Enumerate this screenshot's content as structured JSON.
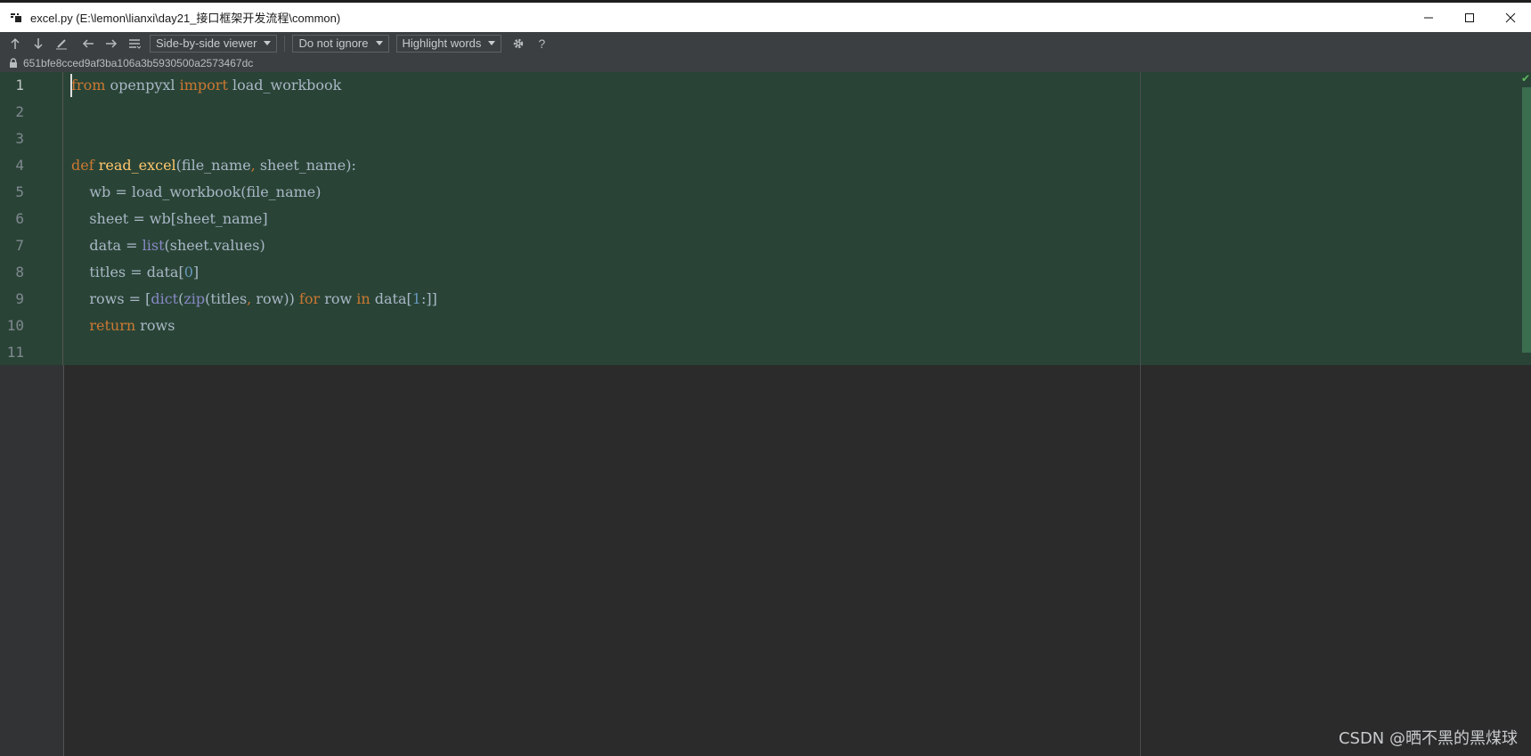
{
  "window": {
    "title": "excel.py (E:\\lemon\\lianxi\\day21_接口框架开发流程\\common)",
    "controls": {
      "minimize": "—",
      "maximize": "☐",
      "close": "✕"
    }
  },
  "toolbar": {
    "viewer_label": "Side-by-side viewer",
    "whitespace_label": "Do not ignore",
    "highlight_label": "Highlight words",
    "help_label": "?"
  },
  "revision": {
    "hash": "651bfe8cced9af3ba106a3b5930500a2573467dc"
  },
  "code": {
    "lines": [
      {
        "num": "1",
        "tokens": [
          [
            "kw",
            "from"
          ],
          [
            "t",
            " openpyxl "
          ],
          [
            "kw",
            "import"
          ],
          [
            "t",
            " load_workbook"
          ]
        ]
      },
      {
        "num": "2",
        "tokens": []
      },
      {
        "num": "3",
        "tokens": []
      },
      {
        "num": "4",
        "tokens": [
          [
            "kw",
            "def"
          ],
          [
            "t",
            " "
          ],
          [
            "fn",
            "read_excel"
          ],
          [
            "t",
            "(file_name"
          ],
          [
            "pun",
            ","
          ],
          [
            "t",
            " sheet_name):"
          ]
        ]
      },
      {
        "num": "5",
        "tokens": [
          [
            "t",
            "    wb = load_workbook(file_name)"
          ]
        ]
      },
      {
        "num": "6",
        "tokens": [
          [
            "t",
            "    sheet = wb[sheet_name]"
          ]
        ]
      },
      {
        "num": "7",
        "tokens": [
          [
            "t",
            "    data = "
          ],
          [
            "bi",
            "list"
          ],
          [
            "t",
            "(sheet.values)"
          ]
        ]
      },
      {
        "num": "8",
        "tokens": [
          [
            "t",
            "    titles = data["
          ],
          [
            "num",
            "0"
          ],
          [
            "t",
            "]"
          ]
        ]
      },
      {
        "num": "9",
        "tokens": [
          [
            "t",
            "    rows = ["
          ],
          [
            "bi",
            "dict"
          ],
          [
            "t",
            "("
          ],
          [
            "bi",
            "zip"
          ],
          [
            "t",
            "(titles"
          ],
          [
            "pun",
            ","
          ],
          [
            "t",
            " row)) "
          ],
          [
            "kw",
            "for"
          ],
          [
            "t",
            " row "
          ],
          [
            "kw",
            "in"
          ],
          [
            "t",
            " data["
          ],
          [
            "num",
            "1"
          ],
          [
            "t",
            ":]]"
          ]
        ]
      },
      {
        "num": "10",
        "tokens": [
          [
            "t",
            "    "
          ],
          [
            "kw",
            "return"
          ],
          [
            "t",
            " rows"
          ]
        ]
      },
      {
        "num": "11",
        "tokens": []
      }
    ]
  },
  "watermark": "CSDN @晒不黑的黑煤球",
  "colors": {
    "background": "#2b2b2b",
    "changed_block": "#294436",
    "toolbar": "#3c3f41",
    "keyword": "#cc7832",
    "function": "#ffc66d",
    "builtin": "#8888c6",
    "number": "#6897bb",
    "text": "#a9b7c6"
  },
  "icons": [
    "pycharm-app-icon",
    "arrow-up-icon",
    "arrow-down-icon",
    "edit-icon",
    "arrow-left-icon",
    "arrow-right-icon",
    "list-icon",
    "gear-icon",
    "help-icon",
    "lock-icon",
    "check-icon"
  ]
}
